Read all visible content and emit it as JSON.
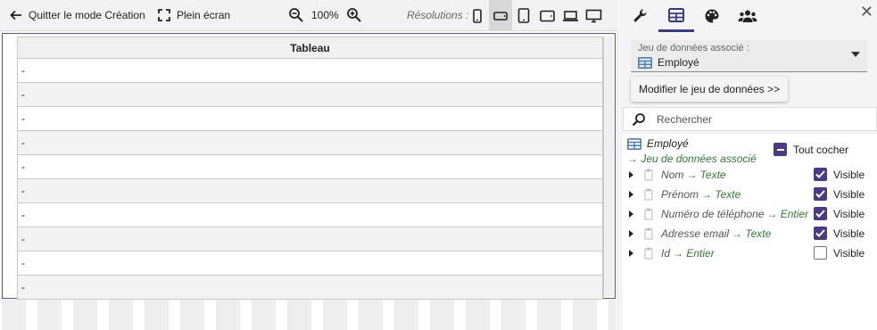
{
  "toolbar": {
    "quit_label": "Quitter le mode Création",
    "fullscreen_label": "Plein écran",
    "zoom_value": "100%",
    "resolutions_label": "Résolutions :"
  },
  "table": {
    "header": "Tableau",
    "rows": [
      "-",
      "-",
      "-",
      "-",
      "-",
      "-",
      "-",
      "-",
      "-",
      "-"
    ]
  },
  "panel": {
    "dataset_label": "Jeu de données associé :",
    "dataset_value": "Employé",
    "modify_button": "Modifier le jeu de données >>",
    "search_placeholder": "Rechercher",
    "tree": {
      "root_name": "Employé",
      "root_sub": "→ Jeu de données associé",
      "check_all_label": "Tout cocher",
      "fields": [
        {
          "name": "Nom",
          "type": "→ Texte",
          "visible_label": "Visible",
          "checked": true
        },
        {
          "name": "Prénom",
          "type": "→ Texte",
          "visible_label": "Visible",
          "checked": true
        },
        {
          "name": "Numéro de téléphone",
          "type": "→ Entier",
          "visible_label": "Visible",
          "checked": true
        },
        {
          "name": "Adresse email",
          "type": "→ Texte",
          "visible_label": "Visible",
          "checked": true
        },
        {
          "name": "Id",
          "type": "→ Entier",
          "visible_label": "Visible",
          "checked": false
        }
      ]
    }
  },
  "colors": {
    "accent": "#4a3a8a",
    "type_green": "#2e7d32",
    "table_icon_blue": "#4a7fb5"
  },
  "icons": [
    "arrow-left-icon",
    "fullscreen-icon",
    "zoom-out-icon",
    "zoom-in-icon",
    "phone-portrait-icon",
    "phone-landscape-icon",
    "tablet-portrait-icon",
    "tablet-landscape-icon",
    "laptop-icon",
    "desktop-icon",
    "wrench-icon",
    "table-icon",
    "palette-icon",
    "users-icon",
    "close-icon",
    "search-icon",
    "document-icon"
  ]
}
